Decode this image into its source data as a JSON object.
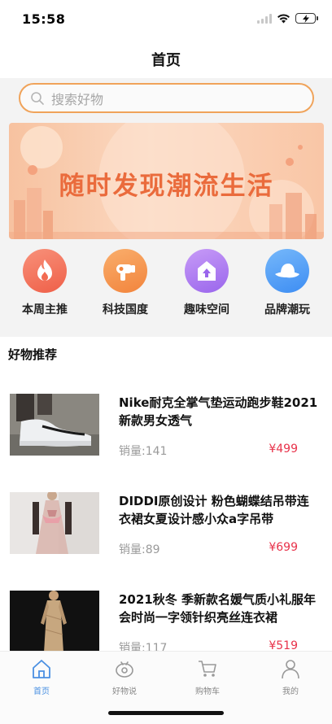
{
  "status": {
    "time": "15:58"
  },
  "nav": {
    "title": "首页"
  },
  "search": {
    "placeholder": "搜索好物"
  },
  "banner": {
    "text": "随时发现潮流生活"
  },
  "categories": [
    {
      "label": "本周主推",
      "icon": "flame-icon",
      "color": "#f5704f"
    },
    {
      "label": "科技国度",
      "icon": "hair-dryer-icon",
      "color": "#f5944a"
    },
    {
      "label": "趣味空间",
      "icon": "upload-bag-icon",
      "color": "#b27ef2"
    },
    {
      "label": "品牌潮玩",
      "icon": "hat-icon",
      "color": "#4c9ff5"
    }
  ],
  "section": {
    "title": "好物推荐"
  },
  "products": [
    {
      "title": "Nike耐克全掌气垫运动跑步鞋2021新款男女透气",
      "sales": "销量:141",
      "price": "¥499"
    },
    {
      "title": "DIDDI原创设计 粉色蝴蝶结吊带连衣裙女夏设计感小众a字吊带",
      "sales": "销量:89",
      "price": "¥699"
    },
    {
      "title": "2021秋冬 季新款名媛气质小礼服年会时尚一字领针织亮丝连衣裙",
      "sales": "销量:117",
      "price": "¥519"
    }
  ],
  "tabs": [
    {
      "label": "首页",
      "icon": "home-icon",
      "active": true
    },
    {
      "label": "好物说",
      "icon": "chat-eye-icon",
      "active": false
    },
    {
      "label": "购物车",
      "icon": "cart-icon",
      "active": false
    },
    {
      "label": "我的",
      "icon": "user-icon",
      "active": false
    }
  ],
  "colors": {
    "accent": "#f0a35a",
    "price": "#e8324a",
    "tab_active": "#4a90e2"
  }
}
